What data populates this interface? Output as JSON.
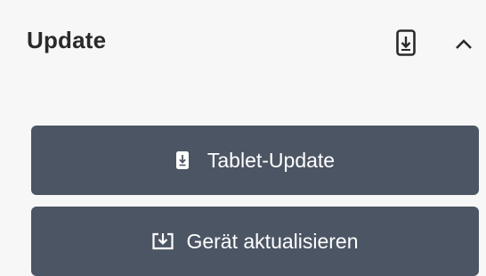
{
  "panel": {
    "title": "Update",
    "header_icons": [
      "tablet-download-icon",
      "chevron-up-icon"
    ]
  },
  "buttons": {
    "tablet_update": {
      "label": "Tablet-Update",
      "icon": "tablet-download-icon"
    },
    "device_update": {
      "label": "Gerät aktualisieren",
      "icon": "download-tray-icon"
    }
  },
  "colors": {
    "background": "#f7f7f7",
    "button": "#4b5563",
    "button_text": "#ffffff",
    "title_text": "#2a2a2a"
  }
}
